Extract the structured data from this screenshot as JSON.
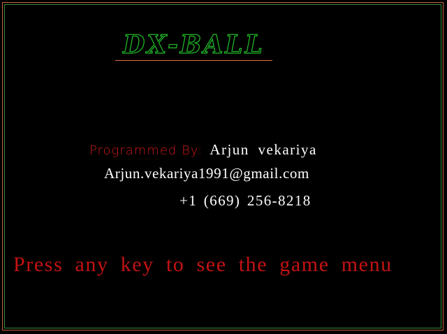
{
  "game": {
    "title": "DX-BALL",
    "credit_label": "Programmed By:",
    "author_name": "Arjun vekariya",
    "email": "Arjun.vekariya1991@gmail.com",
    "phone": "+1 (669) 256-8218",
    "prompt": "Press any key to see the game menu"
  },
  "colors": {
    "background": "#000000",
    "title_outline": "#22c02a",
    "title_underline": "#e07040",
    "credit_label": "#d01818",
    "contact_text": "#ffffff",
    "prompt_text": "#c41212",
    "frame_outer": "#c8643c",
    "frame_inner": "#2e8b3a"
  }
}
